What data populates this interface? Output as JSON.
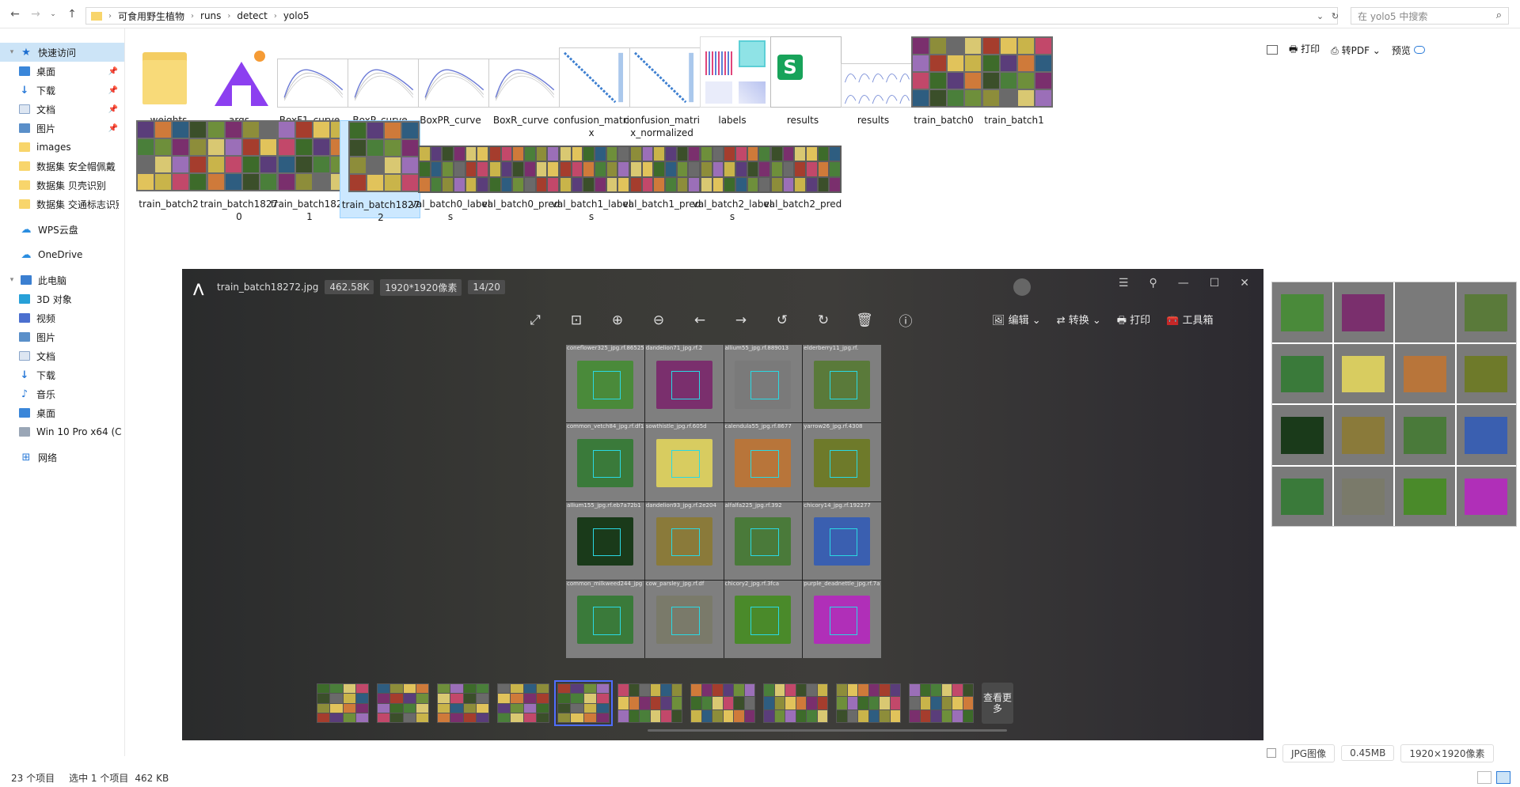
{
  "address": {
    "path": [
      "可食用野生植物",
      "runs",
      "detect",
      "yolo5"
    ],
    "search_placeholder": "在 yolo5 中搜索"
  },
  "sidebar": {
    "items": [
      {
        "label": "快速访问",
        "level": 0,
        "icon": "star-icon",
        "selected": true
      },
      {
        "label": "桌面",
        "level": 1,
        "icon": "desktop-icon",
        "pinned": true
      },
      {
        "label": "下载",
        "level": 1,
        "icon": "download-icon",
        "pinned": true
      },
      {
        "label": "文档",
        "level": 1,
        "icon": "document-icon",
        "pinned": true
      },
      {
        "label": "图片",
        "level": 1,
        "icon": "picture-icon",
        "pinned": true
      },
      {
        "label": "images",
        "level": 1,
        "icon": "folder-icon"
      },
      {
        "label": "数据集 安全帽佩戴",
        "level": 1,
        "icon": "folder-icon"
      },
      {
        "label": "数据集 贝壳识别",
        "level": 1,
        "icon": "folder-icon"
      },
      {
        "label": "数据集 交通标志识别",
        "level": 1,
        "icon": "folder-icon"
      },
      {
        "label": "WPS云盘",
        "level": 0,
        "icon": "cloud-icon"
      },
      {
        "label": "OneDrive",
        "level": 0,
        "icon": "onedrive-icon"
      },
      {
        "label": "此电脑",
        "level": 0,
        "icon": "computer-icon"
      },
      {
        "label": "3D 对象",
        "level": 1,
        "icon": "3d-object-icon"
      },
      {
        "label": "视频",
        "level": 1,
        "icon": "video-icon"
      },
      {
        "label": "图片",
        "level": 1,
        "icon": "picture-icon"
      },
      {
        "label": "文档",
        "level": 1,
        "icon": "document-icon"
      },
      {
        "label": "下载",
        "level": 1,
        "icon": "download-icon"
      },
      {
        "label": "音乐",
        "level": 1,
        "icon": "music-icon"
      },
      {
        "label": "桌面",
        "level": 1,
        "icon": "desktop-icon"
      },
      {
        "label": "Win 10 Pro x64 (C",
        "level": 1,
        "icon": "drive-icon"
      },
      {
        "label": "网络",
        "level": 0,
        "icon": "network-icon"
      }
    ]
  },
  "files": [
    {
      "name": "weights",
      "kind": "folder"
    },
    {
      "name": "args",
      "kind": "app"
    },
    {
      "name": "BoxF1_curve",
      "kind": "chart"
    },
    {
      "name": "BoxP_curve",
      "kind": "chart"
    },
    {
      "name": "BoxPR_curve",
      "kind": "chart"
    },
    {
      "name": "BoxR_curve",
      "kind": "chart"
    },
    {
      "name": "confusion_matrix",
      "kind": "cm"
    },
    {
      "name": "confusion_matrix_normalized",
      "kind": "cm"
    },
    {
      "name": "labels",
      "kind": "labels"
    },
    {
      "name": "results",
      "kind": "sheet"
    },
    {
      "name": "results",
      "kind": "results"
    },
    {
      "name": "train_batch0",
      "kind": "mosaic"
    },
    {
      "name": "train_batch1",
      "kind": "mosaic"
    },
    {
      "name": "train_batch2",
      "kind": "mosaic"
    },
    {
      "name": "train_batch18270",
      "kind": "mosaic"
    },
    {
      "name": "train_batch18271",
      "kind": "mosaic"
    },
    {
      "name": "train_batch18272",
      "kind": "mosaic",
      "selected": true
    },
    {
      "name": "val_batch0_labels",
      "kind": "wide"
    },
    {
      "name": "val_batch0_pred",
      "kind": "wide"
    },
    {
      "name": "val_batch1_labels",
      "kind": "wide"
    },
    {
      "name": "val_batch1_pred",
      "kind": "wide"
    },
    {
      "name": "val_batch2_labels",
      "kind": "wide"
    },
    {
      "name": "val_batch2_pred",
      "kind": "wide"
    }
  ],
  "right_panel": {
    "print": "打印",
    "to_pdf": "转PDF",
    "preview": "预览",
    "type": "JPG图像",
    "size": "0.45MB",
    "dims": "1920×1920像素"
  },
  "status": {
    "count": "23 个项目",
    "selection": "选中 1 个项目",
    "size": "462 KB"
  },
  "viewer": {
    "filename": "train_batch18272.jpg",
    "filesize": "462.58K",
    "dimensions": "1920*1920像素",
    "position": "14/20",
    "actions": {
      "edit": "编辑",
      "convert": "转换",
      "print": "打印",
      "toolbox": "工具箱"
    },
    "more": "查看更多",
    "cell_labels": [
      "coneflower325_jpg.rf.86525",
      "dandelion71_jpg.rf.2",
      "allium55_jpg.rf.889013",
      "elderberry11_jpg.rf.",
      "common_vetch84_jpg.rf.df1",
      "sowthistle_jpg.rf.605d",
      "calendula55_jpg.rf.8677",
      "yarrow26_jpg.rf.4308",
      "allium155_jpg.rf.eb7a72b1",
      "dandelion93_jpg.rf.2e204",
      "alfalfa225_jpg.rf.392",
      "chicory14_jpg.rf.192277",
      "common_milkweed244_jpg",
      "cow_parsley_jpg.rf.df",
      "chicory2_jpg.rf.3fca",
      "purple_deadnettle_jpg.rf.7a"
    ]
  },
  "colors": {
    "accent": "#2b7bd8",
    "selection": "#cce8ff",
    "viewer_bg": "#333333",
    "box_cyan": "#2ad9e3"
  }
}
